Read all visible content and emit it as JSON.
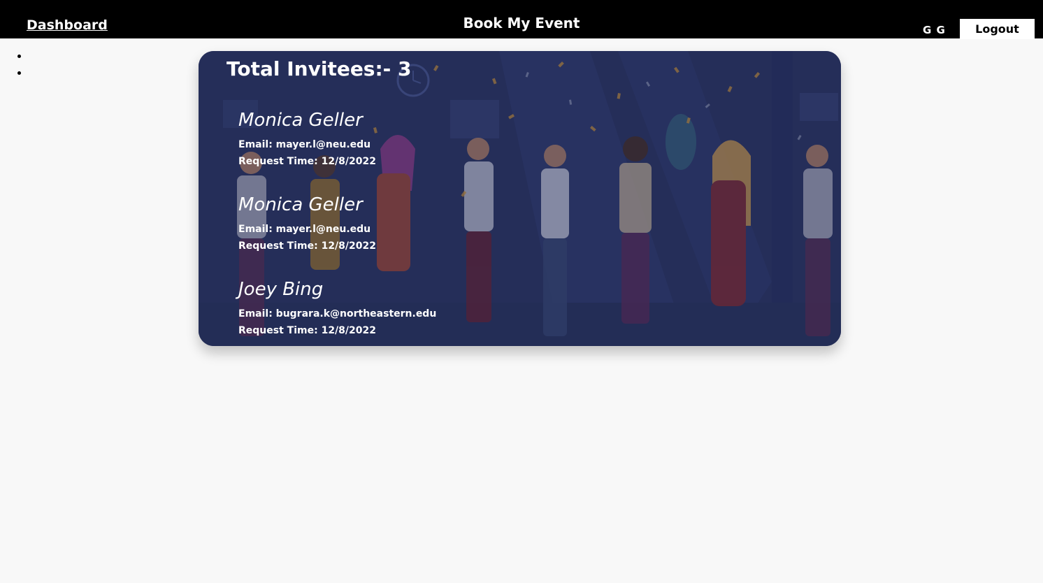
{
  "header": {
    "dashboard_link": "Dashboard",
    "app_title": "Book My Event",
    "user_initials": "G G",
    "logout_label": "Logout"
  },
  "sidebar": {
    "bullet_count": 2
  },
  "invitees_card": {
    "total_label": "Total Invitees:- 3",
    "email_prefix": "Email:",
    "request_prefix": "Request Time:",
    "invitees": [
      {
        "name": "Monica Geller",
        "email": "mayer.l@neu.edu",
        "request_time": "12/8/2022"
      },
      {
        "name": "Monica Geller",
        "email": "mayer.l@neu.edu",
        "request_time": "12/8/2022"
      },
      {
        "name": "Joey Bing",
        "email": "bugrara.k@northeastern.edu",
        "request_time": "12/8/2022"
      }
    ]
  },
  "colors": {
    "topbar": "#000000",
    "page_background": "#f8f8f8",
    "card_overlay": "#2a3460"
  }
}
